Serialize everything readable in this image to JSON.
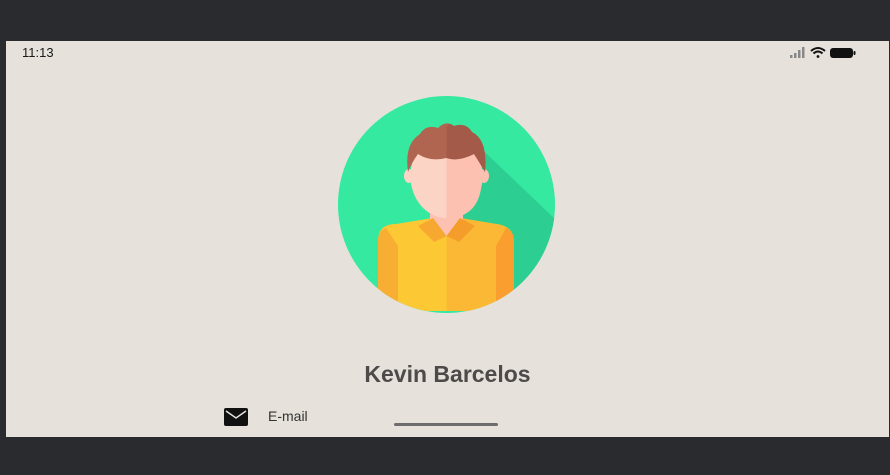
{
  "status_bar": {
    "time": "11:13"
  },
  "profile": {
    "name": "Kevin Barcelos"
  },
  "contact": {
    "email_label": "E-mail"
  },
  "colors": {
    "background": "#e6e1db",
    "avatar_bg": "#35e9a1",
    "shirt": "#fbc531"
  }
}
